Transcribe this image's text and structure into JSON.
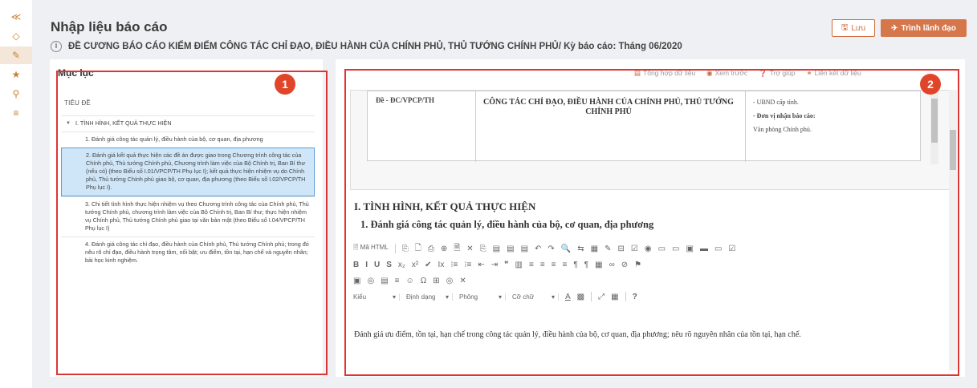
{
  "rail": {
    "items": [
      {
        "icon": "share-icon",
        "glyph": "≪"
      },
      {
        "icon": "diamond-icon",
        "glyph": "◇"
      },
      {
        "icon": "edit-icon",
        "glyph": "✎"
      },
      {
        "icon": "star-icon",
        "glyph": "★"
      },
      {
        "icon": "search-icon",
        "glyph": "⚲"
      },
      {
        "icon": "list-icon",
        "glyph": "≡"
      }
    ]
  },
  "header": {
    "title": "Nhập liệu báo cáo",
    "subtitle": "ĐỀ CƯƠNG BÁO CÁO KIỂM ĐIỂM CÔNG TÁC CHỈ ĐẠO, ĐIỀU HÀNH CỦA CHÍNH PHỦ, THỦ TƯỚNG CHÍNH PHỦ/ Kỳ báo cáo: Tháng 06/2020",
    "save_label": "Lưu",
    "submit_label": "Trình lãnh đạo"
  },
  "toc": {
    "title": "Mục lục",
    "column_header": "TIÊU ĐỀ",
    "section": "I. TÌNH HÌNH, KẾT QUẢ THỰC HIỆN",
    "items": [
      "1. Đánh giá công tác quản lý, điều hành của bộ, cơ quan, địa phương",
      "2. Đánh giá kết quả thực hiện các đề án được giao trong Chương trình công tác của Chính phủ, Thủ tướng Chính phủ, Chương trình làm việc của Bộ Chính trị, Ban Bí thư (nếu có) (theo Biểu số I.01/VPCP/TH Phụ lục I); kết quả thực hiện nhiệm vụ do Chính phủ, Thủ tướng Chính phủ giao bộ, cơ quan, địa phương (theo Biểu số I.02/VPCP/TH Phụ lục I).",
      "3. Chi tiết tình hình thực hiện nhiệm vụ theo Chương trình công tác của Chính phủ, Thủ tướng Chính phủ, chương trình làm việc của Bộ Chính trị, Ban Bí thư; thực hiện nhiệm vụ Chính phủ, Thủ tướng Chính phủ giao tại văn bản mật (theo Biểu số I.04/VPCP/TH Phụ lục I)",
      "4. Đánh giá công tác chỉ đạo, điều hành của Chính phủ, Thủ tướng Chính phủ; trong đó nêu rõ chỉ đạo, điều hành trọng tâm, nổi bật; ưu điểm, tồn tại, hạn chế và nguyên nhân; bài học kinh nghiệm."
    ],
    "selected_index": 1
  },
  "badges": {
    "left": "1",
    "right": "2"
  },
  "actions": [
    {
      "icon": "sum-icon",
      "glyph": "▤",
      "label": "Tổng hợp dữ liệu"
    },
    {
      "icon": "eye-icon",
      "glyph": "◉",
      "label": "Xem trước"
    },
    {
      "icon": "help-icon",
      "glyph": "❓",
      "label": "Trợ giúp"
    },
    {
      "icon": "link-icon",
      "glyph": "⚭",
      "label": "Liên kết dữ liệu"
    }
  ],
  "document": {
    "code": "Đề - ĐC/VPCP/TH",
    "title": "CÔNG TÁC CHỈ ĐẠO, ĐIỀU HÀNH CỦA CHÍNH PHỦ, THỦ TƯỚNG CHÍNH PHỦ",
    "sender": "- UBND cấp tỉnh.",
    "recipient_label": "- Đơn vị nhận báo cáo:",
    "recipient": "Văn phòng Chính phủ."
  },
  "section_h1": "I. TÌNH HÌNH, KẾT QUẢ THỰC HIỆN",
  "section_h2": "1. Đánh giá công tác quản lý, điều hành của bộ, cơ quan, địa phương",
  "toolbar": {
    "source_label": "Mã HTML",
    "row1": [
      "⎘",
      "🗋",
      "⎙",
      "⊕",
      "🗎",
      "✕",
      "⎘",
      "▤",
      "▤",
      "▤",
      "↶",
      "↷",
      "🔍",
      "⇆",
      "▦",
      "✎",
      "⊟",
      "☑",
      "◉",
      "▭",
      "▭",
      "▣",
      "▬",
      "▭",
      "☑"
    ],
    "row2": [
      "B",
      "I",
      "U",
      "S",
      "x₂",
      "x²",
      "✔",
      "Ix",
      "⁝≡",
      "⁝≡",
      "⇤",
      "⇥",
      "❞",
      "▥",
      "≡",
      "≡",
      "≡",
      "≡",
      "¶",
      "¶",
      "▦",
      "∞",
      "⊘",
      "⚑"
    ],
    "row3": [
      "▣",
      "◎",
      "▤",
      "≡",
      "☺",
      "Ω",
      "⊞",
      "◎",
      "✕"
    ],
    "selects": [
      "Kiểu",
      "Định dạng",
      "Phông",
      "Cỡ chữ"
    ],
    "extras": [
      "A",
      "▩",
      "⤢",
      "▦",
      "?"
    ]
  },
  "editor_text": "Đánh giá ưu điểm, tồn tại, hạn chế trong công tác quản lý, điều hành của bộ, cơ quan, địa phương; nêu rõ nguyên nhân của tồn tại, hạn chế."
}
